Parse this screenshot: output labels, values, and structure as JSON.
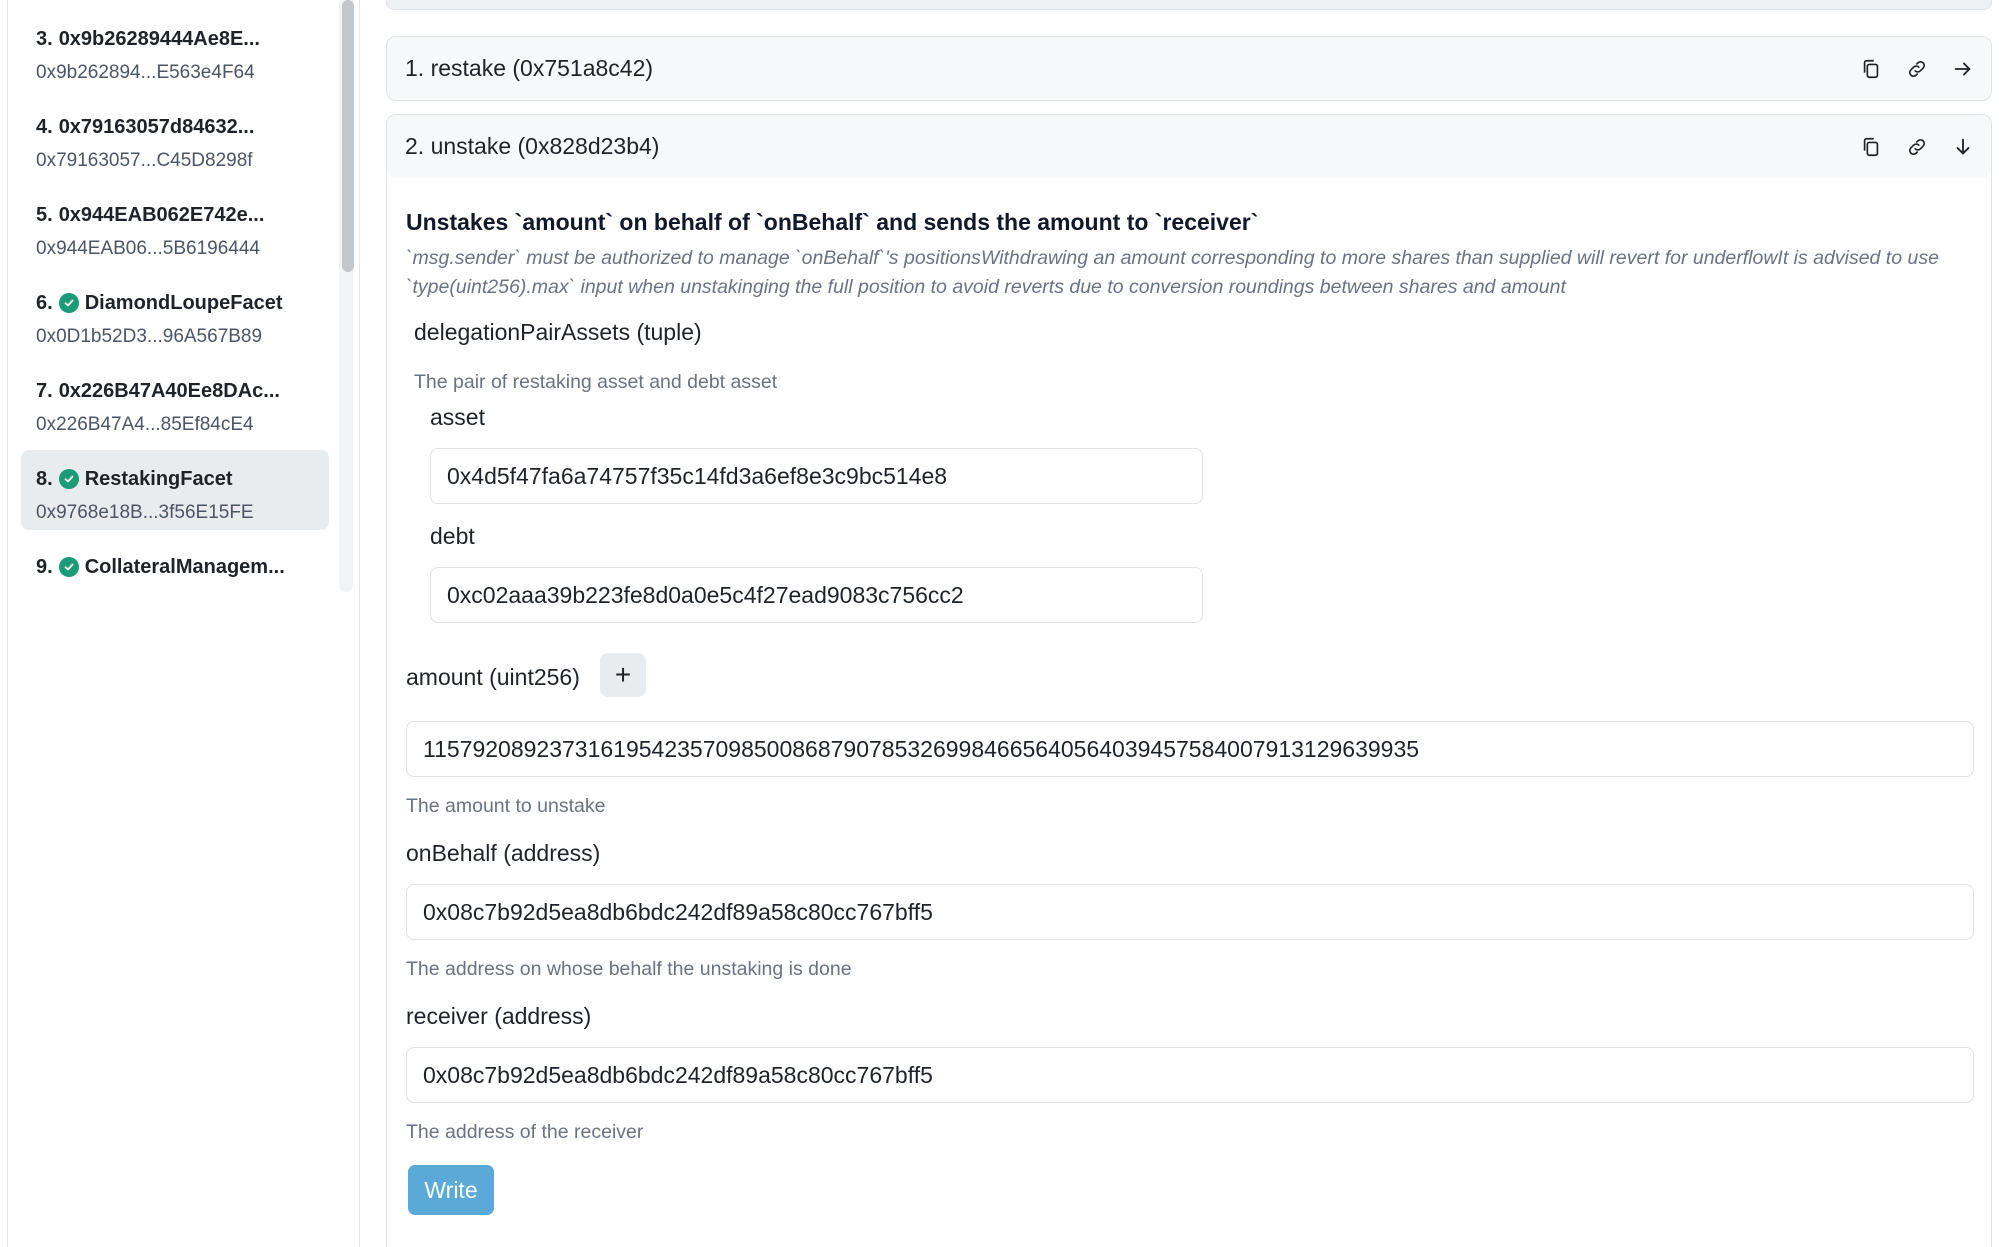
{
  "sidebar": {
    "items": [
      {
        "num": "3.",
        "title": "0x9b26289444Ae8E...",
        "address": "0x9b262894...E563e4F64",
        "verified": false,
        "active": false
      },
      {
        "num": "4.",
        "title": "0x79163057d84632...",
        "address": "0x79163057...C45D8298f",
        "verified": false,
        "active": false
      },
      {
        "num": "5.",
        "title": "0x944EAB062E742e...",
        "address": "0x944EAB06...5B6196444",
        "verified": false,
        "active": false
      },
      {
        "num": "6.",
        "title": "DiamondLoupeFacet",
        "address": "0x0D1b52D3...96A567B89",
        "verified": true,
        "active": false
      },
      {
        "num": "7.",
        "title": "0x226B47A40Ee8DAc...",
        "address": "0x226B47A4...85Ef84cE4",
        "verified": false,
        "active": false
      },
      {
        "num": "8.",
        "title": "RestakingFacet",
        "address": "0x9768e18B...3f56E15FE",
        "verified": true,
        "active": true
      },
      {
        "num": "9.",
        "title": "CollateralManagem...",
        "address": "",
        "verified": true,
        "active": false
      }
    ]
  },
  "functions": {
    "restake": {
      "title": "1. restake (0x751a8c42)"
    },
    "unstake": {
      "title": "2. unstake (0x828d23b4)",
      "notice": "Unstakes `amount` on behalf of `onBehalf` and sends the amount to `receiver`",
      "dev": "`msg.sender` must be authorized to manage `onBehalf`'s positionsWithdrawing an amount corresponding to more shares than supplied will revert for underflowIt is advised to use `type(uint256).max` input when unstakinging the full position to avoid reverts due to conversion roundings between shares and amount",
      "tuple": {
        "label": "delegationPairAssets (tuple)",
        "help": "The pair of restaking asset and debt asset",
        "asset_label": "asset",
        "asset_value": "0x4d5f47fa6a74757f35c14fd3a6ef8e3c9bc514e8",
        "debt_label": "debt",
        "debt_value": "0xc02aaa39b223fe8d0a0e5c4f27ead9083c756cc2"
      },
      "amount": {
        "label": "amount (uint256)",
        "plus": "+",
        "value": "115792089237316195423570985008687907853269984665640564039457584007913129639935",
        "help": "The amount to unstake"
      },
      "onBehalf": {
        "label": "onBehalf (address)",
        "value": "0x08c7b92d5ea8db6bdc242df89a58c80cc767bff5",
        "help": "The address on whose behalf the unstaking is done"
      },
      "receiver": {
        "label": "receiver (address)",
        "value": "0x08c7b92d5ea8db6bdc242df89a58c80cc767bff5",
        "help": "The address of the receiver"
      },
      "write_label": "Write"
    }
  },
  "icons": {
    "copy": "copy-icon",
    "link": "link-icon",
    "arrow_right": "arrow-right-icon",
    "arrow_down": "arrow-down-icon",
    "check": "check-circle-icon"
  },
  "colors": {
    "accent": "#5aa9d6",
    "verified": "#1a9a76",
    "active_bg": "#e9ecef"
  }
}
